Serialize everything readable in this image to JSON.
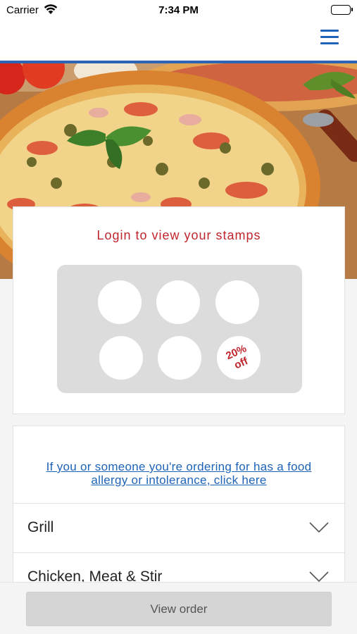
{
  "status_bar": {
    "carrier": "Carrier",
    "time": "7:34 PM",
    "icons": [
      "wifi-icon",
      "battery-icon"
    ]
  },
  "nav": {
    "menu_icon": "hamburger-menu-icon",
    "accent_color": "#2c64b6"
  },
  "hero": {
    "image": "pizza-photo"
  },
  "loyalty": {
    "title": "Login to view your stamps",
    "stamps_total": 6,
    "stamps_collected": 0,
    "reward_text": "20%\noff",
    "title_color": "#c0262d"
  },
  "menu": {
    "allergy_link": "If you or someone you're ordering for has a food allergy or intolerance, click here",
    "categories": [
      {
        "label": "Grill"
      },
      {
        "label": "Chicken, Meat & Stir"
      }
    ]
  },
  "footer": {
    "view_order_label": "View order"
  }
}
